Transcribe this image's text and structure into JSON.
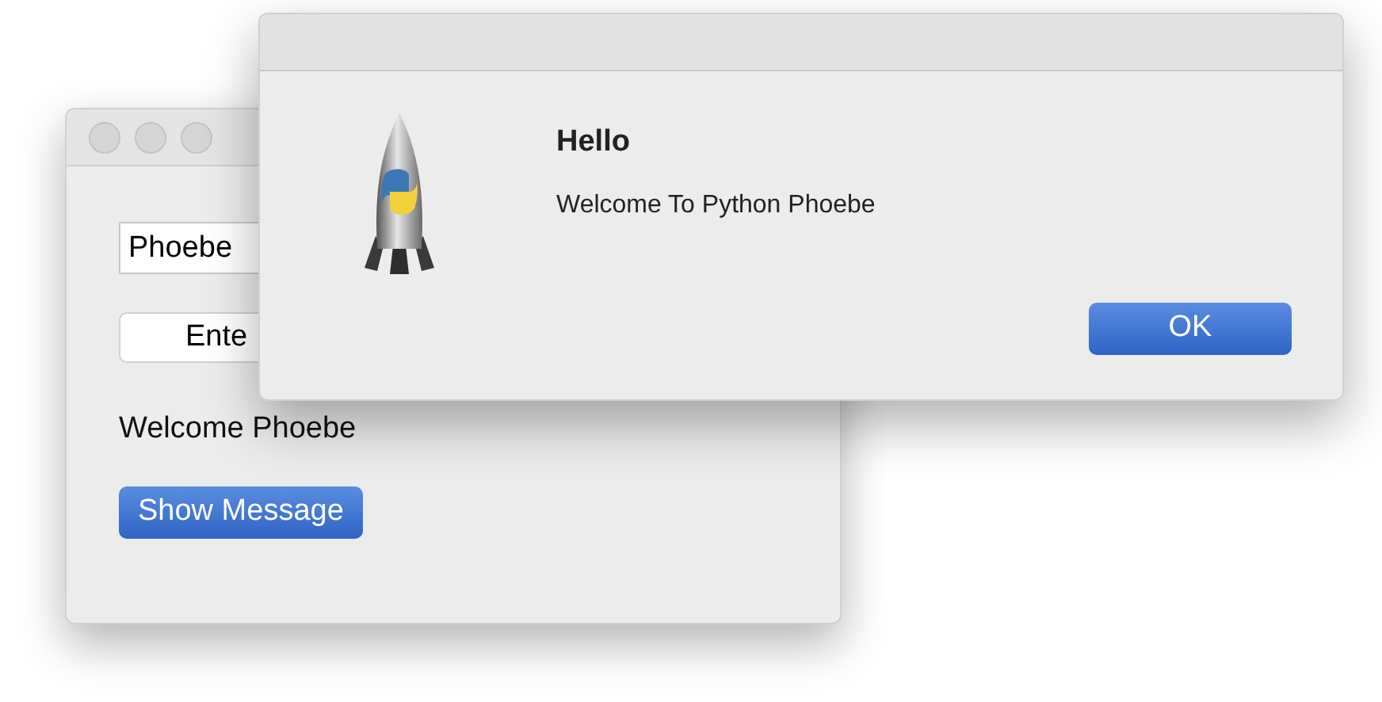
{
  "main_window": {
    "name_field": {
      "value": "Phoebe"
    },
    "enter_button": {
      "label": "Ente"
    },
    "greeting": "Welcome Phoebe",
    "show_button": {
      "label": "Show Message"
    }
  },
  "dialog": {
    "title": "Hello",
    "message": "Welcome To Python Phoebe",
    "button": {
      "label": "OK"
    }
  }
}
